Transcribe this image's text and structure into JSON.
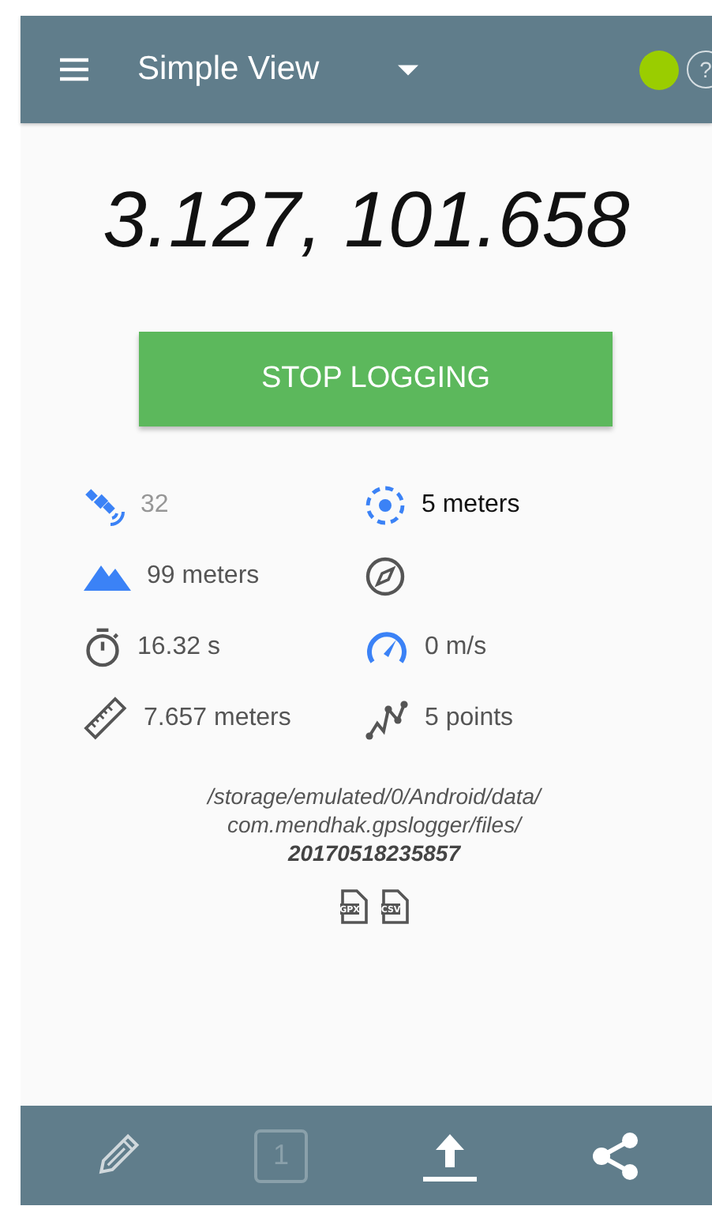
{
  "app_bar": {
    "title": "Simple View",
    "gps_active": true,
    "help": "?"
  },
  "coordinates": "3.127, 101.658",
  "logging_button": {
    "label": "STOP LOGGING"
  },
  "stats": [
    {
      "kind": "satellite",
      "value": "32",
      "dimmed": true,
      "emphasized": false
    },
    {
      "kind": "accuracy",
      "value": "5 meters",
      "dimmed": false,
      "emphasized": true
    },
    {
      "kind": "altitude",
      "value": "99 meters",
      "dimmed": false,
      "emphasized": false
    },
    {
      "kind": "compass"
    },
    {
      "kind": "timer",
      "value": "16.32 s",
      "dimmed": false,
      "emphasized": false
    },
    {
      "kind": "speed",
      "value": "0 m/s",
      "dimmed": false,
      "emphasized": false
    },
    {
      "kind": "distance",
      "value": "7.657 meters",
      "dimmed": false,
      "emphasized": false
    },
    {
      "kind": "points",
      "value": "5 points",
      "dimmed": false,
      "emphasized": false
    }
  ],
  "file_path": {
    "lines": [
      "/storage/emulated/0/Android/data/",
      "com.mendhak.gpslogger/files/"
    ],
    "file_name": "20170518235857"
  },
  "file_types": [
    "GPX",
    "CSV"
  ],
  "bottom_bar": [
    {
      "kind": "annotate"
    },
    {
      "kind": "counter",
      "label": "1",
      "disabled": true
    },
    {
      "kind": "upload"
    },
    {
      "kind": "share"
    }
  ]
}
